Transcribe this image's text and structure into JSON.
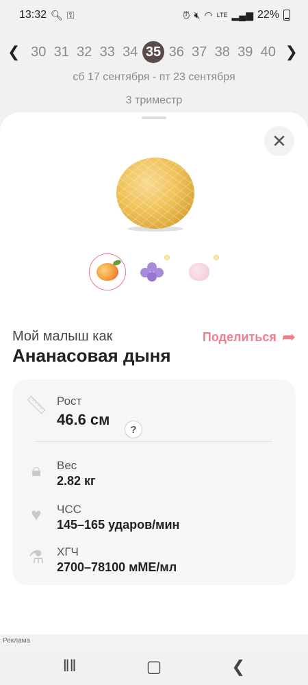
{
  "status": {
    "time": "13:32",
    "battery": "22%",
    "left_icons": [
      "search-icon",
      "key-icon"
    ],
    "right_icons": [
      "alarm-icon",
      "mute-icon",
      "wifi-icon",
      "volte-icon",
      "signal-icon",
      "battery-icon"
    ]
  },
  "weeks": {
    "items": [
      "30",
      "31",
      "32",
      "33",
      "34",
      "35",
      "36",
      "37",
      "38",
      "39",
      "40"
    ],
    "selected": "35"
  },
  "date_range": "сб 17 сентября - пт 23 сентября",
  "trimester": "3 триместр",
  "comparisons": [
    "peach",
    "violet-flower",
    "marshmallow"
  ],
  "baby": {
    "intro": "Мой малыш как",
    "name": "Ананасовая дыня",
    "share_label": "Поделиться"
  },
  "stats": {
    "height_label": "Рост",
    "height_value": "46.6 см",
    "help": "?",
    "weight_label": "Вес",
    "weight_value": "2.82 кг",
    "hr_label": "ЧСС",
    "hr_value": "145–165 ударов/мин",
    "hcg_label": "ХГЧ",
    "hcg_value": "2700–78100 мМЕ/мл"
  },
  "ad_label": "Реклама",
  "colors": {
    "accent": "#ef7f8b",
    "selected_week_bg": "#5a4a4a"
  }
}
